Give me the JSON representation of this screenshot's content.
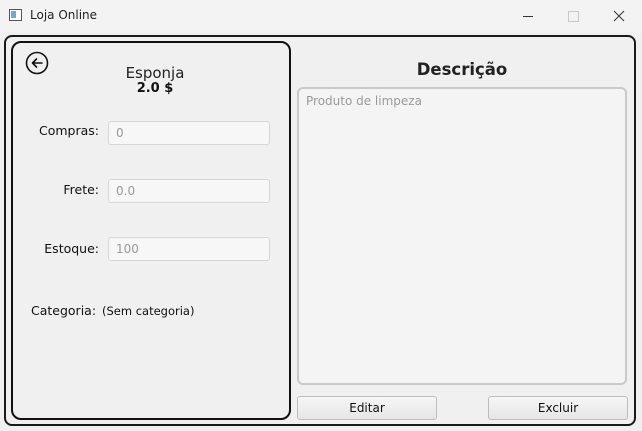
{
  "window": {
    "title": "Loja Online",
    "app_icon": "window-app-icon",
    "controls": [
      "minimize-icon",
      "maximize-icon",
      "close-icon"
    ]
  },
  "product": {
    "back_icon": "arrow-left-circle-icon",
    "name": "Esponja",
    "price": "2.0 $"
  },
  "fields": {
    "compras_label": "Compras:",
    "compras_value": "0",
    "frete_label": "Frete:",
    "frete_value": "0.0",
    "estoque_label": "Estoque:",
    "estoque_value": "100"
  },
  "category": {
    "label": "Categoria:",
    "value": "(Sem categoria)"
  },
  "description": {
    "title": "Descrição",
    "text": "Produto de limpeza"
  },
  "actions": {
    "edit_label": "Editar",
    "delete_label": "Excluir"
  }
}
